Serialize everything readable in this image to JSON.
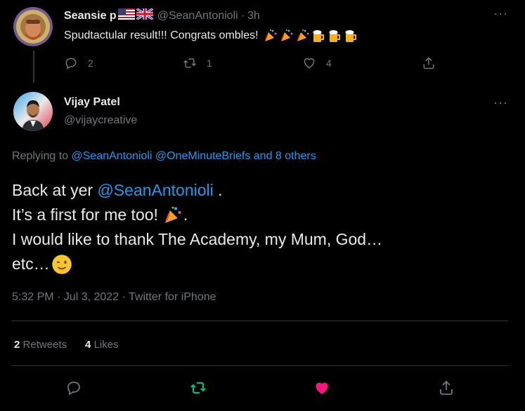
{
  "reply": {
    "name": "Seansie p",
    "handle": "@SeanAntonioli",
    "sep": "·",
    "time": "3h",
    "text": "Spudtactular result!!! Congrats ombles!",
    "reply_count": "2",
    "retweet_count": "1",
    "like_count": "4"
  },
  "main": {
    "name": "Vijay Patel",
    "handle": "@vijaycreative",
    "replying_prefix": "Replying to",
    "replying_users": "@SeanAntonioli @OneMinuteBriefs and 8 others",
    "line1_a": "Back at yer",
    "line1_mention": "@SeanAntonioli",
    "line1_b": ".",
    "line2": "It’s a first for me too!",
    "line2_end": ".",
    "line3": "I would like to thank The Academy, my Mum, God…",
    "line4": "etc…",
    "meta": "5:32 PM · Jul 3, 2022 · Twitter for iPhone",
    "retweets_count": "2",
    "retweets_label": "Retweets",
    "likes_count": "4",
    "likes_label": "Likes"
  },
  "colors": {
    "accent": "#1d9bf0",
    "retweet_green": "#00ba7c",
    "like_pink": "#f91880",
    "muted": "#71767b"
  },
  "icons": [
    "reply-icon",
    "retweet-icon",
    "like-icon",
    "share-icon",
    "more-icon"
  ]
}
